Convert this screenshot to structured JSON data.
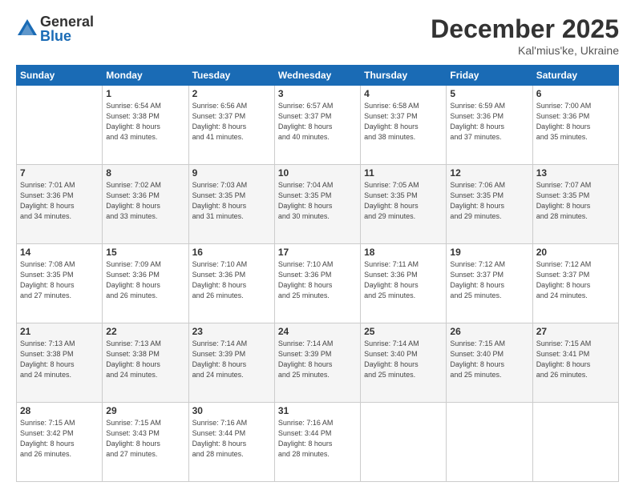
{
  "logo": {
    "general": "General",
    "blue": "Blue"
  },
  "header": {
    "month": "December 2025",
    "location": "Kal'mius'ke, Ukraine"
  },
  "weekdays": [
    "Sunday",
    "Monday",
    "Tuesday",
    "Wednesday",
    "Thursday",
    "Friday",
    "Saturday"
  ],
  "weeks": [
    [
      {
        "day": "",
        "info": ""
      },
      {
        "day": "1",
        "info": "Sunrise: 6:54 AM\nSunset: 3:38 PM\nDaylight: 8 hours\nand 43 minutes."
      },
      {
        "day": "2",
        "info": "Sunrise: 6:56 AM\nSunset: 3:37 PM\nDaylight: 8 hours\nand 41 minutes."
      },
      {
        "day": "3",
        "info": "Sunrise: 6:57 AM\nSunset: 3:37 PM\nDaylight: 8 hours\nand 40 minutes."
      },
      {
        "day": "4",
        "info": "Sunrise: 6:58 AM\nSunset: 3:37 PM\nDaylight: 8 hours\nand 38 minutes."
      },
      {
        "day": "5",
        "info": "Sunrise: 6:59 AM\nSunset: 3:36 PM\nDaylight: 8 hours\nand 37 minutes."
      },
      {
        "day": "6",
        "info": "Sunrise: 7:00 AM\nSunset: 3:36 PM\nDaylight: 8 hours\nand 35 minutes."
      }
    ],
    [
      {
        "day": "7",
        "info": "Sunrise: 7:01 AM\nSunset: 3:36 PM\nDaylight: 8 hours\nand 34 minutes."
      },
      {
        "day": "8",
        "info": "Sunrise: 7:02 AM\nSunset: 3:36 PM\nDaylight: 8 hours\nand 33 minutes."
      },
      {
        "day": "9",
        "info": "Sunrise: 7:03 AM\nSunset: 3:35 PM\nDaylight: 8 hours\nand 31 minutes."
      },
      {
        "day": "10",
        "info": "Sunrise: 7:04 AM\nSunset: 3:35 PM\nDaylight: 8 hours\nand 30 minutes."
      },
      {
        "day": "11",
        "info": "Sunrise: 7:05 AM\nSunset: 3:35 PM\nDaylight: 8 hours\nand 29 minutes."
      },
      {
        "day": "12",
        "info": "Sunrise: 7:06 AM\nSunset: 3:35 PM\nDaylight: 8 hours\nand 29 minutes."
      },
      {
        "day": "13",
        "info": "Sunrise: 7:07 AM\nSunset: 3:35 PM\nDaylight: 8 hours\nand 28 minutes."
      }
    ],
    [
      {
        "day": "14",
        "info": "Sunrise: 7:08 AM\nSunset: 3:35 PM\nDaylight: 8 hours\nand 27 minutes."
      },
      {
        "day": "15",
        "info": "Sunrise: 7:09 AM\nSunset: 3:36 PM\nDaylight: 8 hours\nand 26 minutes."
      },
      {
        "day": "16",
        "info": "Sunrise: 7:10 AM\nSunset: 3:36 PM\nDaylight: 8 hours\nand 26 minutes."
      },
      {
        "day": "17",
        "info": "Sunrise: 7:10 AM\nSunset: 3:36 PM\nDaylight: 8 hours\nand 25 minutes."
      },
      {
        "day": "18",
        "info": "Sunrise: 7:11 AM\nSunset: 3:36 PM\nDaylight: 8 hours\nand 25 minutes."
      },
      {
        "day": "19",
        "info": "Sunrise: 7:12 AM\nSunset: 3:37 PM\nDaylight: 8 hours\nand 25 minutes."
      },
      {
        "day": "20",
        "info": "Sunrise: 7:12 AM\nSunset: 3:37 PM\nDaylight: 8 hours\nand 24 minutes."
      }
    ],
    [
      {
        "day": "21",
        "info": "Sunrise: 7:13 AM\nSunset: 3:38 PM\nDaylight: 8 hours\nand 24 minutes."
      },
      {
        "day": "22",
        "info": "Sunrise: 7:13 AM\nSunset: 3:38 PM\nDaylight: 8 hours\nand 24 minutes."
      },
      {
        "day": "23",
        "info": "Sunrise: 7:14 AM\nSunset: 3:39 PM\nDaylight: 8 hours\nand 24 minutes."
      },
      {
        "day": "24",
        "info": "Sunrise: 7:14 AM\nSunset: 3:39 PM\nDaylight: 8 hours\nand 25 minutes."
      },
      {
        "day": "25",
        "info": "Sunrise: 7:14 AM\nSunset: 3:40 PM\nDaylight: 8 hours\nand 25 minutes."
      },
      {
        "day": "26",
        "info": "Sunrise: 7:15 AM\nSunset: 3:40 PM\nDaylight: 8 hours\nand 25 minutes."
      },
      {
        "day": "27",
        "info": "Sunrise: 7:15 AM\nSunset: 3:41 PM\nDaylight: 8 hours\nand 26 minutes."
      }
    ],
    [
      {
        "day": "28",
        "info": "Sunrise: 7:15 AM\nSunset: 3:42 PM\nDaylight: 8 hours\nand 26 minutes."
      },
      {
        "day": "29",
        "info": "Sunrise: 7:15 AM\nSunset: 3:43 PM\nDaylight: 8 hours\nand 27 minutes."
      },
      {
        "day": "30",
        "info": "Sunrise: 7:16 AM\nSunset: 3:44 PM\nDaylight: 8 hours\nand 28 minutes."
      },
      {
        "day": "31",
        "info": "Sunrise: 7:16 AM\nSunset: 3:44 PM\nDaylight: 8 hours\nand 28 minutes."
      },
      {
        "day": "",
        "info": ""
      },
      {
        "day": "",
        "info": ""
      },
      {
        "day": "",
        "info": ""
      }
    ]
  ]
}
